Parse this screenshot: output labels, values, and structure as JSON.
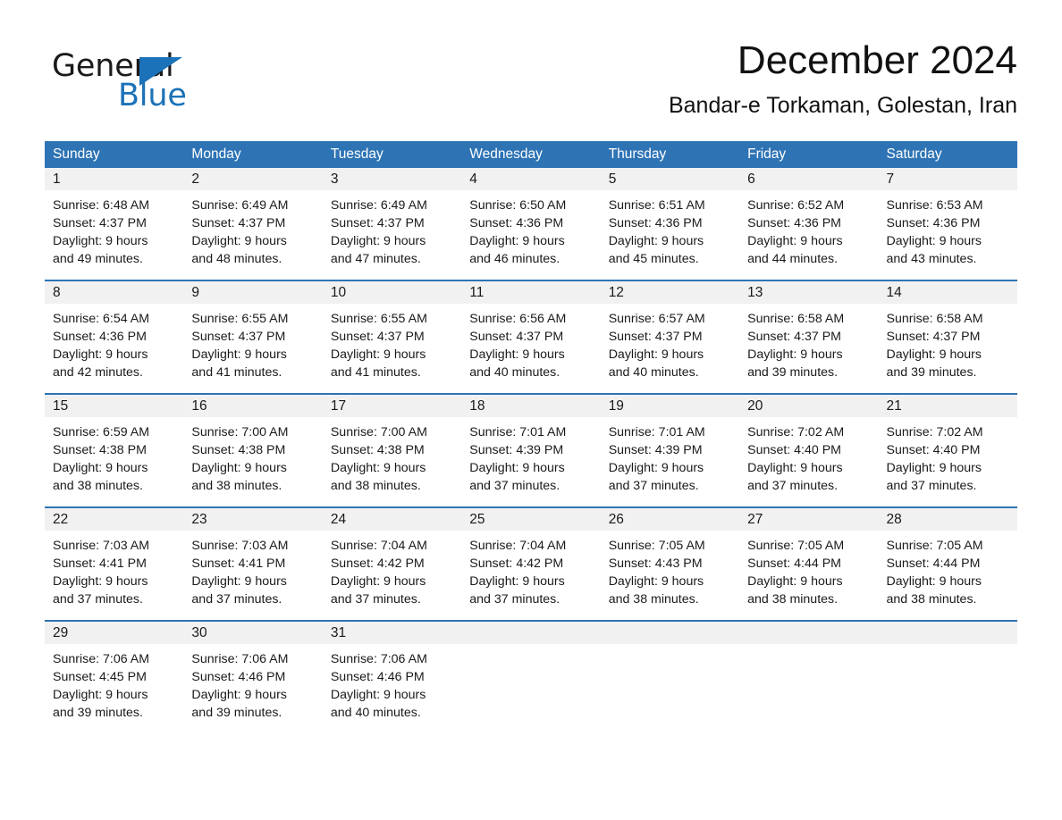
{
  "brand": {
    "name_part1": "General",
    "name_part2": "Blue",
    "triangle_icon": "triangle-icon",
    "accent_color": "#1b72b8"
  },
  "header": {
    "title": "December 2024",
    "subtitle": "Bandar-e Torkaman, Golestan, Iran"
  },
  "theme": {
    "header_blue": "#2e74b5",
    "daynum_gray": "#f1f1f1",
    "text_black": "#1a1a1a"
  },
  "calendar": {
    "weekdays": [
      "Sunday",
      "Monday",
      "Tuesday",
      "Wednesday",
      "Thursday",
      "Friday",
      "Saturday"
    ],
    "weeks": [
      [
        {
          "day": "1",
          "sunrise": "Sunrise: 6:48 AM",
          "sunset": "Sunset: 4:37 PM",
          "daylight1": "Daylight: 9 hours",
          "daylight2": "and 49 minutes."
        },
        {
          "day": "2",
          "sunrise": "Sunrise: 6:49 AM",
          "sunset": "Sunset: 4:37 PM",
          "daylight1": "Daylight: 9 hours",
          "daylight2": "and 48 minutes."
        },
        {
          "day": "3",
          "sunrise": "Sunrise: 6:49 AM",
          "sunset": "Sunset: 4:37 PM",
          "daylight1": "Daylight: 9 hours",
          "daylight2": "and 47 minutes."
        },
        {
          "day": "4",
          "sunrise": "Sunrise: 6:50 AM",
          "sunset": "Sunset: 4:36 PM",
          "daylight1": "Daylight: 9 hours",
          "daylight2": "and 46 minutes."
        },
        {
          "day": "5",
          "sunrise": "Sunrise: 6:51 AM",
          "sunset": "Sunset: 4:36 PM",
          "daylight1": "Daylight: 9 hours",
          "daylight2": "and 45 minutes."
        },
        {
          "day": "6",
          "sunrise": "Sunrise: 6:52 AM",
          "sunset": "Sunset: 4:36 PM",
          "daylight1": "Daylight: 9 hours",
          "daylight2": "and 44 minutes."
        },
        {
          "day": "7",
          "sunrise": "Sunrise: 6:53 AM",
          "sunset": "Sunset: 4:36 PM",
          "daylight1": "Daylight: 9 hours",
          "daylight2": "and 43 minutes."
        }
      ],
      [
        {
          "day": "8",
          "sunrise": "Sunrise: 6:54 AM",
          "sunset": "Sunset: 4:36 PM",
          "daylight1": "Daylight: 9 hours",
          "daylight2": "and 42 minutes."
        },
        {
          "day": "9",
          "sunrise": "Sunrise: 6:55 AM",
          "sunset": "Sunset: 4:37 PM",
          "daylight1": "Daylight: 9 hours",
          "daylight2": "and 41 minutes."
        },
        {
          "day": "10",
          "sunrise": "Sunrise: 6:55 AM",
          "sunset": "Sunset: 4:37 PM",
          "daylight1": "Daylight: 9 hours",
          "daylight2": "and 41 minutes."
        },
        {
          "day": "11",
          "sunrise": "Sunrise: 6:56 AM",
          "sunset": "Sunset: 4:37 PM",
          "daylight1": "Daylight: 9 hours",
          "daylight2": "and 40 minutes."
        },
        {
          "day": "12",
          "sunrise": "Sunrise: 6:57 AM",
          "sunset": "Sunset: 4:37 PM",
          "daylight1": "Daylight: 9 hours",
          "daylight2": "and 40 minutes."
        },
        {
          "day": "13",
          "sunrise": "Sunrise: 6:58 AM",
          "sunset": "Sunset: 4:37 PM",
          "daylight1": "Daylight: 9 hours",
          "daylight2": "and 39 minutes."
        },
        {
          "day": "14",
          "sunrise": "Sunrise: 6:58 AM",
          "sunset": "Sunset: 4:37 PM",
          "daylight1": "Daylight: 9 hours",
          "daylight2": "and 39 minutes."
        }
      ],
      [
        {
          "day": "15",
          "sunrise": "Sunrise: 6:59 AM",
          "sunset": "Sunset: 4:38 PM",
          "daylight1": "Daylight: 9 hours",
          "daylight2": "and 38 minutes."
        },
        {
          "day": "16",
          "sunrise": "Sunrise: 7:00 AM",
          "sunset": "Sunset: 4:38 PM",
          "daylight1": "Daylight: 9 hours",
          "daylight2": "and 38 minutes."
        },
        {
          "day": "17",
          "sunrise": "Sunrise: 7:00 AM",
          "sunset": "Sunset: 4:38 PM",
          "daylight1": "Daylight: 9 hours",
          "daylight2": "and 38 minutes."
        },
        {
          "day": "18",
          "sunrise": "Sunrise: 7:01 AM",
          "sunset": "Sunset: 4:39 PM",
          "daylight1": "Daylight: 9 hours",
          "daylight2": "and 37 minutes."
        },
        {
          "day": "19",
          "sunrise": "Sunrise: 7:01 AM",
          "sunset": "Sunset: 4:39 PM",
          "daylight1": "Daylight: 9 hours",
          "daylight2": "and 37 minutes."
        },
        {
          "day": "20",
          "sunrise": "Sunrise: 7:02 AM",
          "sunset": "Sunset: 4:40 PM",
          "daylight1": "Daylight: 9 hours",
          "daylight2": "and 37 minutes."
        },
        {
          "day": "21",
          "sunrise": "Sunrise: 7:02 AM",
          "sunset": "Sunset: 4:40 PM",
          "daylight1": "Daylight: 9 hours",
          "daylight2": "and 37 minutes."
        }
      ],
      [
        {
          "day": "22",
          "sunrise": "Sunrise: 7:03 AM",
          "sunset": "Sunset: 4:41 PM",
          "daylight1": "Daylight: 9 hours",
          "daylight2": "and 37 minutes."
        },
        {
          "day": "23",
          "sunrise": "Sunrise: 7:03 AM",
          "sunset": "Sunset: 4:41 PM",
          "daylight1": "Daylight: 9 hours",
          "daylight2": "and 37 minutes."
        },
        {
          "day": "24",
          "sunrise": "Sunrise: 7:04 AM",
          "sunset": "Sunset: 4:42 PM",
          "daylight1": "Daylight: 9 hours",
          "daylight2": "and 37 minutes."
        },
        {
          "day": "25",
          "sunrise": "Sunrise: 7:04 AM",
          "sunset": "Sunset: 4:42 PM",
          "daylight1": "Daylight: 9 hours",
          "daylight2": "and 37 minutes."
        },
        {
          "day": "26",
          "sunrise": "Sunrise: 7:05 AM",
          "sunset": "Sunset: 4:43 PM",
          "daylight1": "Daylight: 9 hours",
          "daylight2": "and 38 minutes."
        },
        {
          "day": "27",
          "sunrise": "Sunrise: 7:05 AM",
          "sunset": "Sunset: 4:44 PM",
          "daylight1": "Daylight: 9 hours",
          "daylight2": "and 38 minutes."
        },
        {
          "day": "28",
          "sunrise": "Sunrise: 7:05 AM",
          "sunset": "Sunset: 4:44 PM",
          "daylight1": "Daylight: 9 hours",
          "daylight2": "and 38 minutes."
        }
      ],
      [
        {
          "day": "29",
          "sunrise": "Sunrise: 7:06 AM",
          "sunset": "Sunset: 4:45 PM",
          "daylight1": "Daylight: 9 hours",
          "daylight2": "and 39 minutes."
        },
        {
          "day": "30",
          "sunrise": "Sunrise: 7:06 AM",
          "sunset": "Sunset: 4:46 PM",
          "daylight1": "Daylight: 9 hours",
          "daylight2": "and 39 minutes."
        },
        {
          "day": "31",
          "sunrise": "Sunrise: 7:06 AM",
          "sunset": "Sunset: 4:46 PM",
          "daylight1": "Daylight: 9 hours",
          "daylight2": "and 40 minutes."
        },
        {
          "day": "",
          "sunrise": "",
          "sunset": "",
          "daylight1": "",
          "daylight2": ""
        },
        {
          "day": "",
          "sunrise": "",
          "sunset": "",
          "daylight1": "",
          "daylight2": ""
        },
        {
          "day": "",
          "sunrise": "",
          "sunset": "",
          "daylight1": "",
          "daylight2": ""
        },
        {
          "day": "",
          "sunrise": "",
          "sunset": "",
          "daylight1": "",
          "daylight2": ""
        }
      ]
    ]
  }
}
